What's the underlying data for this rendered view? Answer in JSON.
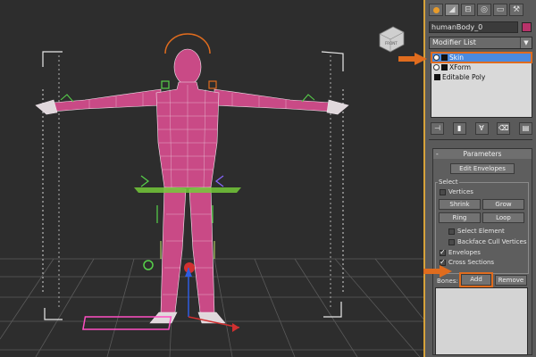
{
  "viewport": {
    "cube_label": "FRONT",
    "axis_labels": [
      "x",
      "y",
      "z"
    ]
  },
  "panel": {
    "tabs": [
      "create-tab",
      "modify-tab",
      "hierarchy-tab",
      "motion-tab",
      "display-tab",
      "utilities-tab"
    ],
    "object_name": "humanBody_0",
    "object_color": "#b8336a",
    "modifier_list_label": "Modifier List",
    "stack_items": [
      {
        "label": "Skin",
        "selected": true
      },
      {
        "label": "XForm",
        "selected": false
      },
      {
        "label": "Editable Poly",
        "selected": false
      }
    ],
    "toolbar_buttons": [
      "pin-stack-icon",
      "show-end-result-icon",
      "make-unique-icon",
      "remove-modifier-icon",
      "configure-sets-icon"
    ]
  },
  "parameters": {
    "title": "Parameters",
    "collapse_sign": "-",
    "edit_envelopes": "Edit Envelopes",
    "select_group": "Select",
    "vertices": "Vertices",
    "shrink": "Shrink",
    "grow": "Grow",
    "ring": "Ring",
    "loop": "Loop",
    "select_element": "Select Element",
    "backface_cull": "Backface Cull Vertices",
    "envelopes": "Envelopes",
    "cross_sections": "Cross Sections",
    "bones_label": "Bones:",
    "add": "Add",
    "remove": "Remove"
  },
  "colors": {
    "accent_orange": "#e06c1e",
    "selection_blue": "#4a8ae0",
    "mesh_pink": "#c94a86",
    "wire_white": "#f2e6ee"
  }
}
